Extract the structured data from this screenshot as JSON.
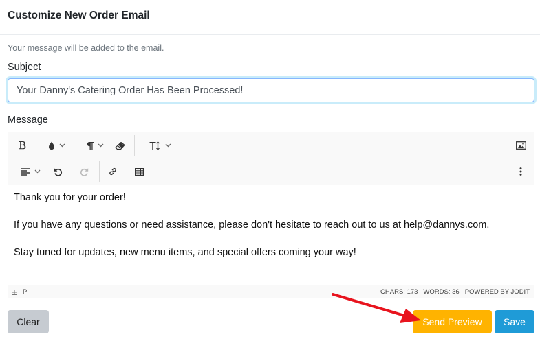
{
  "modal": {
    "title": "Customize New Order Email"
  },
  "hint": "Your message will be added to the email.",
  "subject": {
    "label": "Subject",
    "value": "Your Danny's Catering Order Has Been Processed!"
  },
  "message": {
    "label": "Message",
    "toolbar": {
      "bold": "bold-icon",
      "color": "brush-icon",
      "paragraph": "paragraph-icon",
      "eraser": "eraser-icon",
      "font_size": "font-size-icon",
      "image": "image-icon",
      "align": "align-left-icon",
      "undo": "undo-icon",
      "redo": "redo-icon",
      "link": "link-icon",
      "table": "table-icon",
      "more": "more-vertical-icon"
    },
    "lines": [
      "Thank you for your order!",
      "If you have any questions or need assistance, please don't hesitate to reach out to us at help@dannys.com.",
      "Stay tuned for updates, new menu items, and special offers coming your way!"
    ],
    "status": {
      "element": "P",
      "chars": "CHARS: 173",
      "words": "WORDS: 36",
      "powered": "POWERED BY JODIT"
    }
  },
  "buttons": {
    "clear": "Clear",
    "send_preview": "Send Preview",
    "save": "Save"
  },
  "colors": {
    "send_preview": "#ffb300",
    "save": "#1f9bd7",
    "clear": "#c6cbd1",
    "annotation_arrow": "#e8141e"
  }
}
